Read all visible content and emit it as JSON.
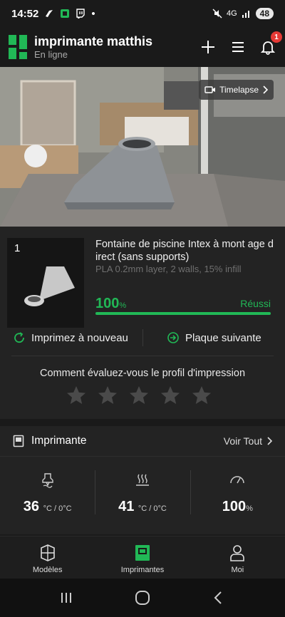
{
  "status_bar": {
    "time": "14:52",
    "network": "4G",
    "battery": "48",
    "app_icons": [
      "plane-icon",
      "app-icon",
      "twitch-icon"
    ],
    "dot": "•"
  },
  "header": {
    "printer_name": "imprimante matthis",
    "printer_status": "En ligne",
    "notification_count": "1",
    "brand_color": "#21b856"
  },
  "camera": {
    "timelapse_label": "Timelapse"
  },
  "job": {
    "plate_number": "1",
    "title": "Fontaine de piscine Intex à mont age direct (sans supports)",
    "meta": "PLA 0.2mm layer, 2 walls, 15% infill",
    "progress_value": "100",
    "progress_unit": "%",
    "progress_fraction": 1.0,
    "status": "Réussi",
    "reprint_label": "Imprimez à nouveau",
    "next_plate_label": "Plaque suivante",
    "rating_question": "Comment évaluez-vous le profil d'impression",
    "rating_max": 5,
    "rating_value": 0
  },
  "printer_section": {
    "title": "Imprimante",
    "see_all_label": "Voir Tout",
    "stats": [
      {
        "icon": "nozzle-icon",
        "value": "36",
        "unit": "°C / 0°C"
      },
      {
        "icon": "heatbed-icon",
        "value": "41",
        "unit": "°C / 0°C"
      },
      {
        "icon": "speed-gauge-icon",
        "value": "100",
        "unit": "%"
      }
    ]
  },
  "bottom_nav": {
    "items": [
      {
        "label": "Modèles",
        "icon": "models-icon",
        "active": false
      },
      {
        "label": "Imprimantes",
        "icon": "printer-icon",
        "active": true
      },
      {
        "label": "Moi",
        "icon": "profile-icon",
        "active": false
      }
    ]
  },
  "system_nav": [
    "recents-icon",
    "home-icon",
    "back-icon"
  ]
}
